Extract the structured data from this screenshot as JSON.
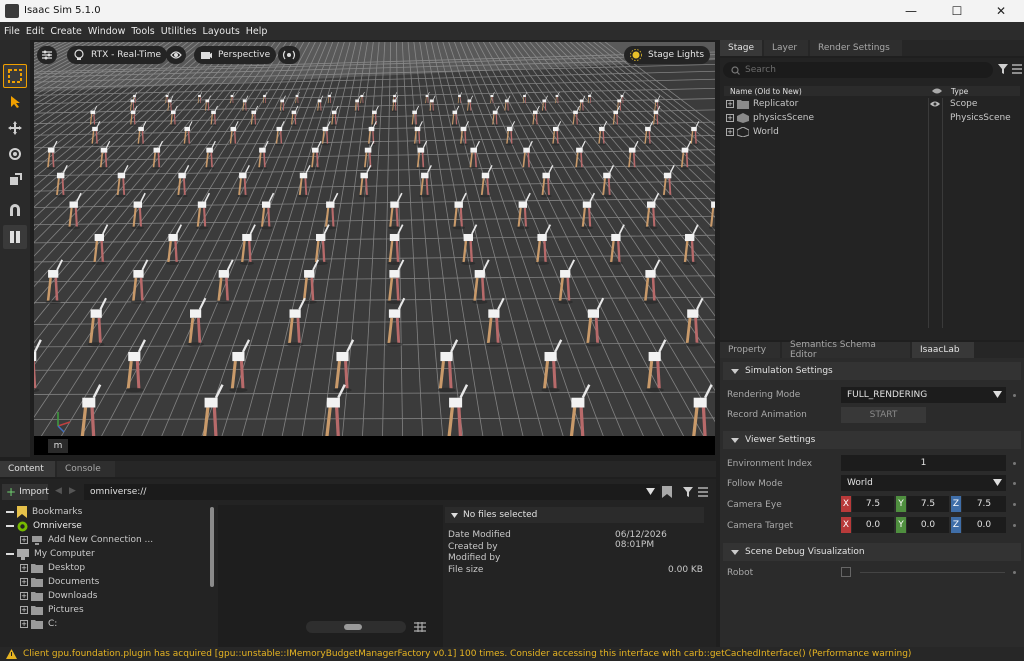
{
  "window": {
    "title": "Isaac Sim 5.1.0",
    "minimize": "—",
    "maximize": "☐",
    "close": "✕"
  },
  "menu": [
    "File",
    "Edit",
    "Create",
    "Window",
    "Tools",
    "Utilities",
    "Layouts",
    "Help"
  ],
  "viewport": {
    "render_mode": "RTX - Real-Time",
    "camera": "Perspective",
    "lights": "Stage Lights",
    "units": "m"
  },
  "stage": {
    "tabs": [
      "Stage",
      "Layer",
      "Render Settings"
    ],
    "search_placeholder": "Search",
    "columns": {
      "name": "Name (Old to New)",
      "type": "Type"
    },
    "rows": [
      {
        "name": "Replicator",
        "type": "Scope"
      },
      {
        "name": "physicsScene",
        "type": "PhysicsScene"
      },
      {
        "name": "World",
        "type": ""
      }
    ]
  },
  "property": {
    "tabs": [
      "Property",
      "Semantics Schema Editor",
      "IsaacLab"
    ],
    "sim_section": "Simulation Settings",
    "rendering_mode_label": "Rendering Mode",
    "rendering_mode_value": "FULL_RENDERING",
    "record_label": "Record Animation",
    "record_button": "START",
    "viewer_section": "Viewer Settings",
    "env_index_label": "Environment Index",
    "env_index_value": "1",
    "follow_label": "Follow Mode",
    "follow_value": "World",
    "cam_eye_label": "Camera Eye",
    "cam_eye": {
      "x": "7.5",
      "y": "7.5",
      "z": "7.5"
    },
    "cam_target_label": "Camera Target",
    "cam_target": {
      "x": "0.0",
      "y": "0.0",
      "z": "0.0"
    },
    "debug_section": "Scene Debug Visualization",
    "robot_label": "Robot",
    "axis_labels": {
      "x": "X",
      "y": "Y",
      "z": "Z"
    }
  },
  "content": {
    "tabs": [
      "Content",
      "Console"
    ],
    "import_label": "Import",
    "path": "omniverse://",
    "tree": [
      {
        "label": "Bookmarks",
        "level": 0
      },
      {
        "label": "Omniverse",
        "level": 0
      },
      {
        "label": "Add New Connection ...",
        "level": 1
      },
      {
        "label": "My Computer",
        "level": 0
      },
      {
        "label": "Desktop",
        "level": 1
      },
      {
        "label": "Documents",
        "level": 1
      },
      {
        "label": "Downloads",
        "level": 1
      },
      {
        "label": "Pictures",
        "level": 1
      },
      {
        "label": "C:",
        "level": 1
      }
    ],
    "details_header": "No files selected",
    "details": [
      {
        "label": "Date Modified",
        "value": "06/12/2026 08:01PM"
      },
      {
        "label": "Created by",
        "value": ""
      },
      {
        "label": "Modified by",
        "value": ""
      },
      {
        "label": "File size",
        "value": "0.00 KB"
      }
    ]
  },
  "status": {
    "message": "Client gpu.foundation.plugin has acquired [gpu::unstable::IMemoryBudgetManagerFactory v0.1] 100 times. Consider accessing this interface with carb::getCachedInterface() (Performance warning)",
    "color": "#e6b422"
  },
  "colors": {
    "accent": "#f0a000",
    "x_axis": "#b83a3a",
    "y_axis": "#4f8f3f",
    "z_axis": "#3f6ea8"
  }
}
